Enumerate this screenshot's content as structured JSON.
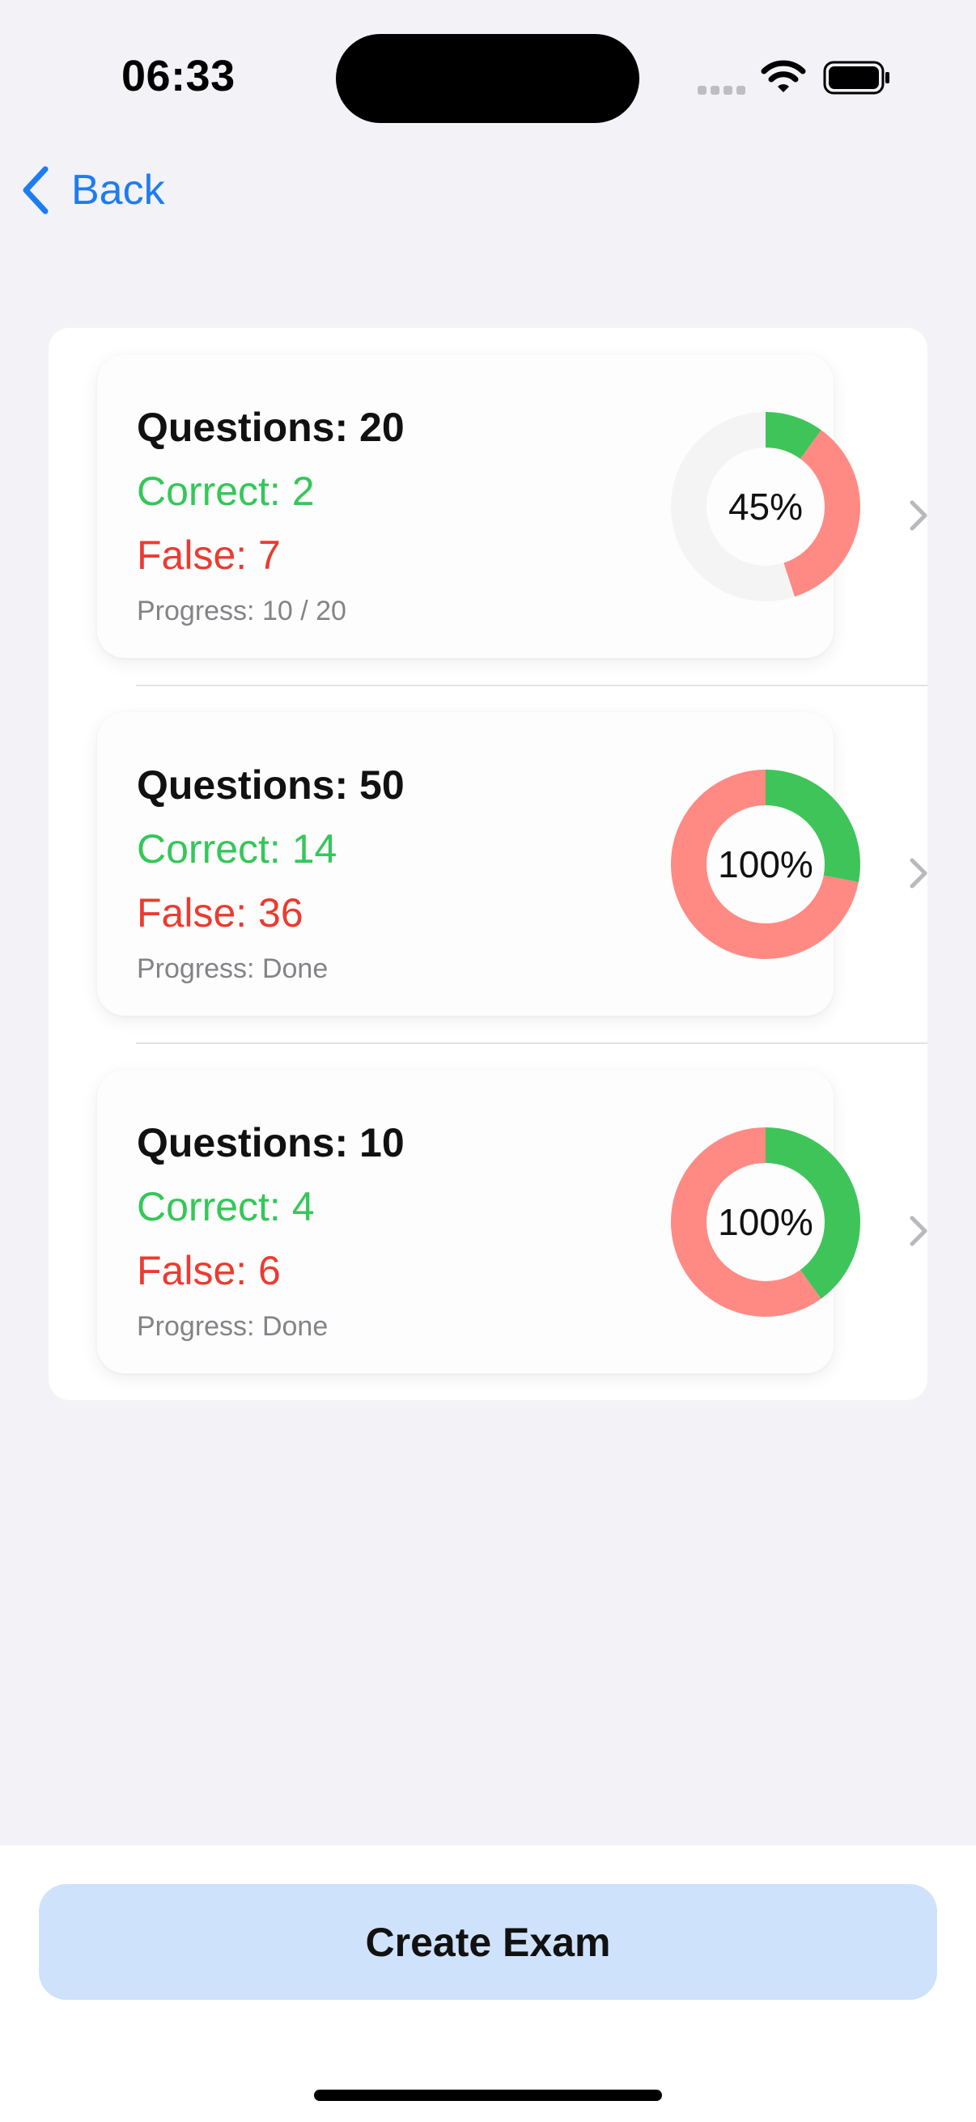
{
  "status_bar": {
    "time": "06:33"
  },
  "nav": {
    "back_label": "Back"
  },
  "exams": [
    {
      "questions": "Questions: 20",
      "correct": "Correct: 2",
      "false": "False: 7",
      "progress": "Progress: 10 / 20",
      "percent_label": "45%",
      "chart": {
        "correct": 2,
        "false": 7,
        "total": 20
      }
    },
    {
      "questions": "Questions: 50",
      "correct": "Correct: 14",
      "false": "False: 36",
      "progress": "Progress: Done",
      "percent_label": "100%",
      "chart": {
        "correct": 14,
        "false": 36,
        "total": 50
      }
    },
    {
      "questions": "Questions: 10",
      "correct": "Correct: 4",
      "false": "False: 6",
      "progress": "Progress: Done",
      "percent_label": "100%",
      "chart": {
        "correct": 4,
        "false": 6,
        "total": 10
      }
    }
  ],
  "create_button": {
    "label": "Create Exam"
  },
  "colors": {
    "accent": "#1E7CF2",
    "correct": "#34C759",
    "false": "#EB3B30",
    "donut_correct": "#3FC45A",
    "donut_false": "#FF8A84",
    "donut_remaining": "#F4F4F4",
    "button_bg": "#CFE2FB"
  }
}
